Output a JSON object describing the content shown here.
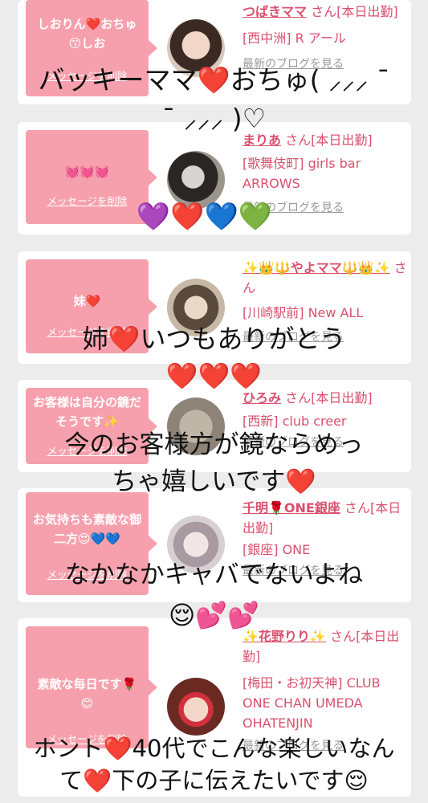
{
  "cards": [
    {
      "msg": "しおりん❤️おちゅ😙しお",
      "del": "メッセージを削除",
      "name": "つばきママ",
      "san": "さん[本日出勤]",
      "shop": "[西中洲] R アール",
      "blog": "最新のブログを見る"
    },
    {
      "msg": "💓💓💓",
      "del": "メッセージを削除",
      "name": "まりあ",
      "san": "さん[本日出勤]",
      "shop": "[歌舞伎町] girls bar ARROWS",
      "blog": "最新のブログを見る"
    },
    {
      "msg": "妹❤️",
      "del": "メッセージを削除",
      "name": "✨👑🔱やよママ🔱👑✨",
      "san": "さん",
      "shop": "[川崎駅前] New ALL",
      "blog": "最新のブログを見る"
    },
    {
      "msg": "お客様は自分の鏡だそうです✨",
      "del": "メッセージを削除",
      "name": "ひろみ",
      "san": "さん[本日出勤]",
      "shop": "[西新] club creer",
      "blog": "最新のブログを見る"
    },
    {
      "msg": "お気持ちも素敵な御二方😍💙💙",
      "del": "メッセージを削除",
      "name": "千明🌹ONE銀座",
      "san": "さん[本日出勤]",
      "shop": "[銀座] ONE",
      "blog": "最新のブログを見る"
    },
    {
      "msg": "素敵な毎日です🌹😊",
      "del": "メッセージを削除",
      "name": "✨花野りり✨",
      "san": "さん[本日出勤]",
      "shop": "[梅田・お初天神] CLUB ONE CHAN UMEDA OHATENJIN",
      "blog": "最新のブログを見る"
    }
  ],
  "overlays": {
    "o1a": "バッキーママ❤️おちゅ( ⸝⸝⸝ ¯",
    "o1b": "¯ ⸝⸝⸝ )♡",
    "o2": "💜❤️💙💚",
    "o3a": "姉❤️いつもありがとう",
    "o3b": "❤️❤️❤️",
    "o4a": "今のお客様方が鏡ならめっ",
    "o4b": "ちゃ嬉しいです❤️",
    "o5a": "なかなかキャバでないよね",
    "o5b": "😌💕💕",
    "o6a": "ホント❤️40代でこんな楽しいなん",
    "o6b": "て❤️下の子に伝えたいです😌"
  }
}
